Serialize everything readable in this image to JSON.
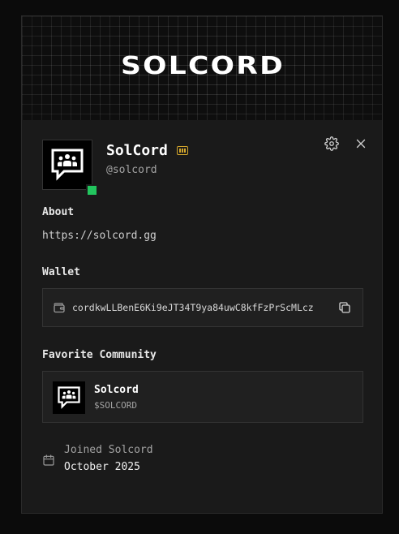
{
  "banner": {
    "logo_text": "SOLCORD"
  },
  "profile": {
    "display_name": "SolCord",
    "handle": "@solcord",
    "status_color": "#22c55e",
    "badge_color": "#d4a72c"
  },
  "about": {
    "label": "About",
    "text": "https://solcord.gg"
  },
  "wallet": {
    "label": "Wallet",
    "address": "cordkwLLBenE6Ki9eJT34T9ya84uwC8kfFzPrScMLcz"
  },
  "favorite_community": {
    "label": "Favorite Community",
    "name": "Solcord",
    "ticker": "$SOLCORD"
  },
  "joined": {
    "label": "Joined Solcord",
    "date": "October 2025"
  },
  "icons": {
    "settings": "gear-icon",
    "close": "close-icon",
    "copy": "copy-icon",
    "wallet": "wallet-icon",
    "calendar": "calendar-icon",
    "avatar": "chat-group-icon",
    "badge": "verified-badge-icon"
  }
}
